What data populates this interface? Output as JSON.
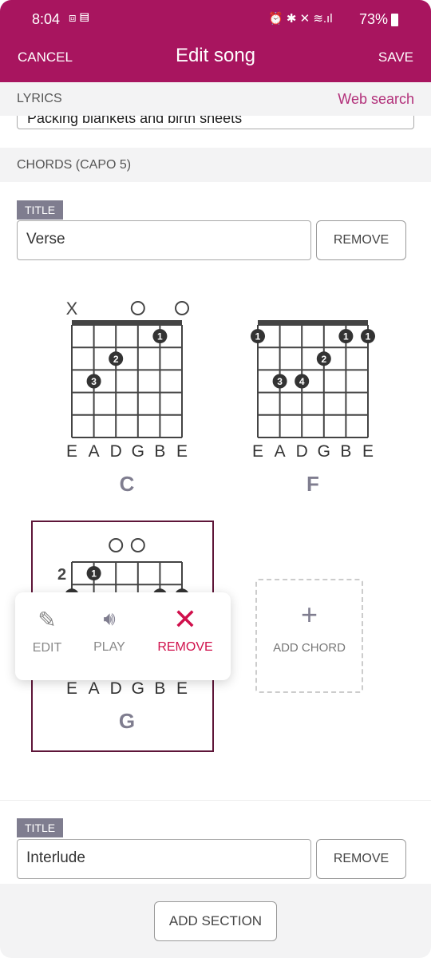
{
  "status_bar": {
    "time": "8:04",
    "battery": "73%"
  },
  "header": {
    "cancel": "CANCEL",
    "title": "Edit song",
    "save": "SAVE",
    "color": "#a8155f"
  },
  "lyrics": {
    "label": "LYRICS",
    "web_search": "Web search",
    "text": "Packing blankets and birth sheets"
  },
  "chords_section": {
    "label": "CHORDS (CAPO 5)"
  },
  "sections": [
    {
      "tag": "TITLE",
      "title": "Verse",
      "remove": "REMOVE"
    },
    {
      "tag": "TITLE",
      "title": "Interlude",
      "remove": "REMOVE"
    }
  ],
  "chords": [
    {
      "name": "C",
      "strings": [
        "E",
        "A",
        "D",
        "G",
        "B",
        "E"
      ],
      "markers": [
        "x",
        "",
        "",
        "o",
        "",
        "o"
      ],
      "base_fret": 1,
      "dots": [
        {
          "s": 4,
          "f": 1,
          "n": "1"
        },
        {
          "s": 2,
          "f": 2,
          "n": "2"
        },
        {
          "s": 1,
          "f": 3,
          "n": "3"
        }
      ]
    },
    {
      "name": "F",
      "strings": [
        "E",
        "A",
        "D",
        "G",
        "B",
        "E"
      ],
      "markers": [
        "",
        "",
        "",
        "",
        "",
        ""
      ],
      "base_fret": 1,
      "dots": [
        {
          "s": 0,
          "f": 1,
          "n": "1"
        },
        {
          "s": 4,
          "f": 1,
          "n": "1"
        },
        {
          "s": 5,
          "f": 1,
          "n": "1"
        },
        {
          "s": 3,
          "f": 2,
          "n": "2"
        },
        {
          "s": 1,
          "f": 3,
          "n": "3"
        },
        {
          "s": 2,
          "f": 3,
          "n": "4"
        }
      ]
    },
    {
      "name": "G",
      "strings": [
        "E",
        "A",
        "D",
        "G",
        "B",
        "E"
      ],
      "markers": [
        "",
        "",
        "o",
        "o",
        "",
        ""
      ],
      "base_fret": 2,
      "selected": true,
      "dots": [
        {
          "s": 1,
          "f": 1,
          "n": "1"
        },
        {
          "s": 0,
          "f": 2,
          "n": ""
        },
        {
          "s": 4,
          "f": 2,
          "n": ""
        },
        {
          "s": 5,
          "f": 2,
          "n": ""
        }
      ]
    }
  ],
  "popup": {
    "edit": "EDIT",
    "play": "PLAY",
    "remove": "REMOVE",
    "remove_color": "#d0104c"
  },
  "add_chord": "ADD CHORD",
  "add_section": "ADD SECTION"
}
